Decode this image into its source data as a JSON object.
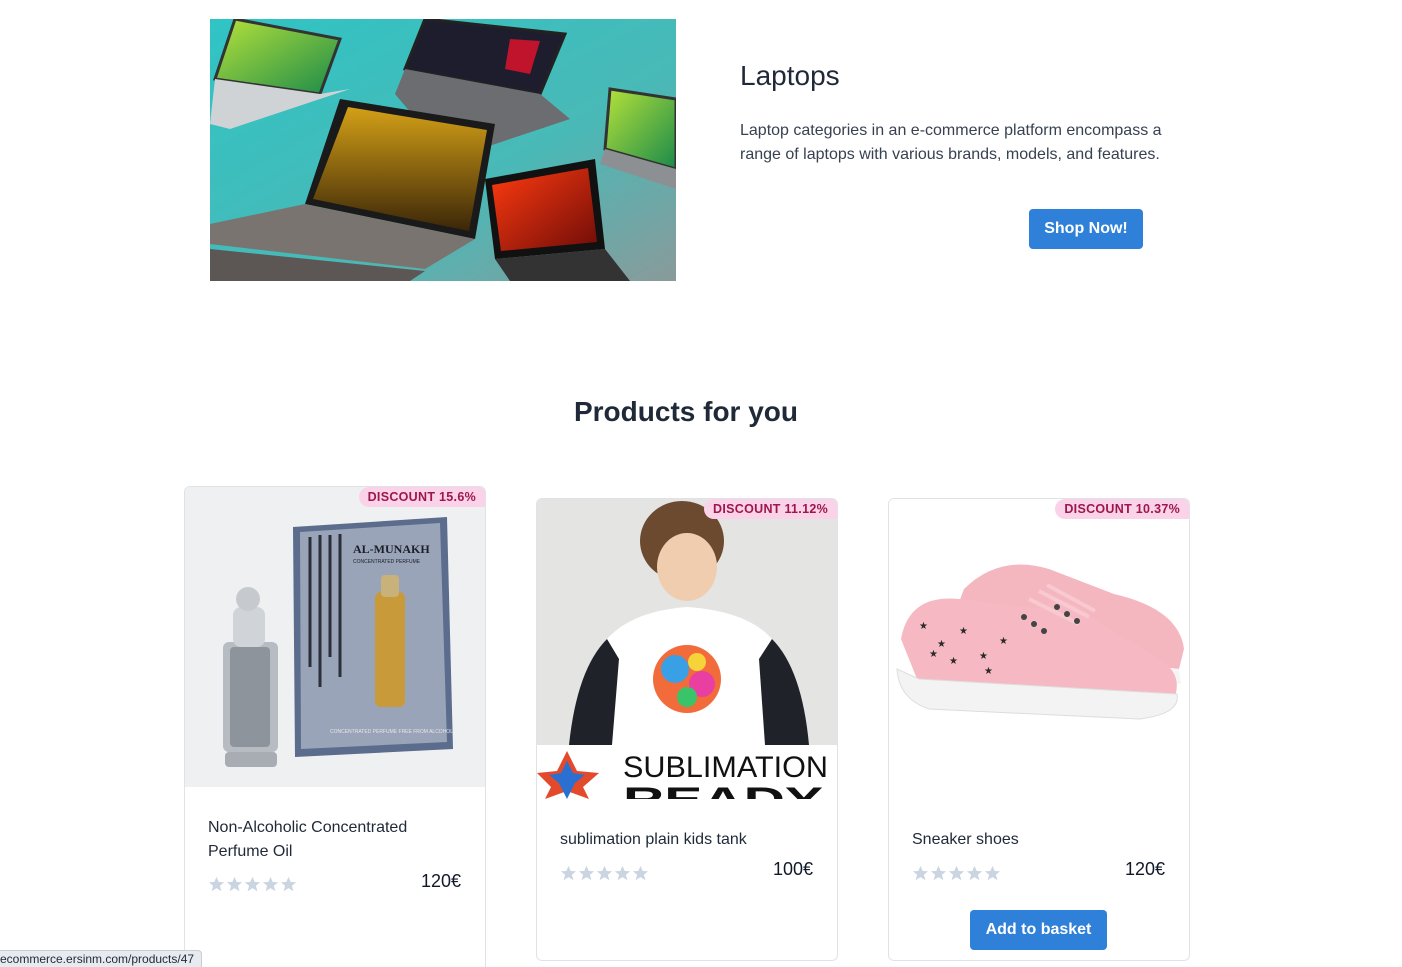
{
  "hero": {
    "title": "Laptops",
    "description": "Laptop categories in an e-commerce platform encompass a range of laptops with various brands, models, and features.",
    "button_label": "Shop Now!",
    "image_alt": "laptops-photo"
  },
  "section": {
    "title": "Products for you"
  },
  "products": [
    {
      "name": "Non-Alcoholic Concentrated Perfume Oil",
      "price": "120€",
      "discount": "DISCOUNT 15.6%",
      "rating": 0,
      "image_text_1": "AL-MUNAKH",
      "image_text_2": "CONCENTRATED PERFUME",
      "image_text_3": "CONCENTRATED PERFUME FREE FROM ALCOHOL"
    },
    {
      "name": "sublimation plain kids tank",
      "price": "100€",
      "discount": "DISCOUNT 11.12%",
      "rating": 0,
      "image_text_1": "SUBLIMATION",
      "image_text_2": "READY"
    },
    {
      "name": "Sneaker shoes",
      "price": "120€",
      "discount": "DISCOUNT 10.37%",
      "rating": 0,
      "button_label": "Add to basket"
    }
  ],
  "status_bar": {
    "url": "ecommerce.ersinm.com/products/47"
  },
  "colors": {
    "accent": "#2f80d8",
    "badge_bg": "#fbd3e8",
    "badge_text": "#9d174d",
    "star_empty": "#cbd5e1"
  }
}
